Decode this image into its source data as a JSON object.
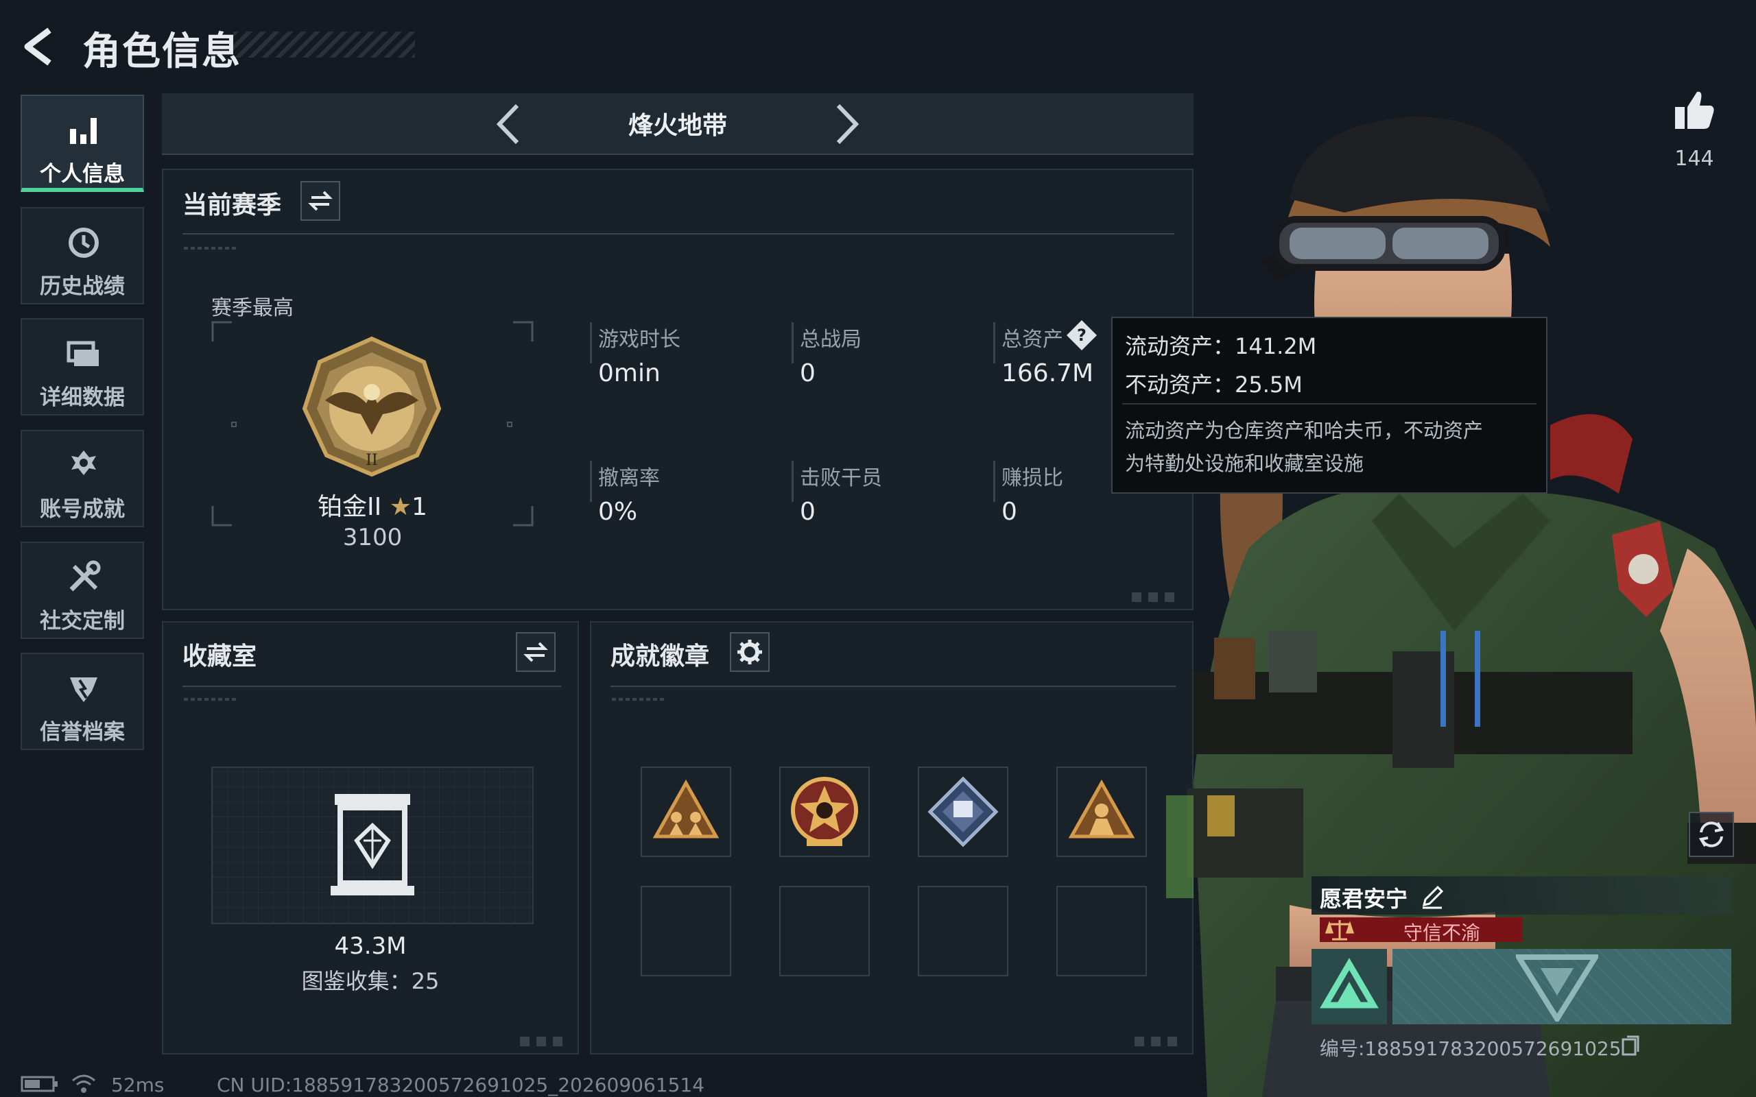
{
  "header": {
    "title": "角色信息"
  },
  "sidebar": {
    "items": [
      {
        "label": "个人信息",
        "icon": "bar-chart-icon",
        "active": true
      },
      {
        "label": "历史战绩",
        "icon": "history-icon"
      },
      {
        "label": "详细数据",
        "icon": "folders-icon"
      },
      {
        "label": "账号成就",
        "icon": "achievement-icon"
      },
      {
        "label": "社交定制",
        "icon": "tools-icon"
      },
      {
        "label": "信誉档案",
        "icon": "shield-icon"
      }
    ]
  },
  "mode_bar": {
    "mode_name": "烽火地带"
  },
  "season_panel": {
    "title": "当前赛季",
    "peak_label": "赛季最高",
    "rank_name": "铂金II",
    "rank_stars": "1",
    "rank_score": "3100",
    "stats": [
      {
        "label": "游戏时长",
        "value": "0min"
      },
      {
        "label": "总战局",
        "value": "0"
      },
      {
        "label": "总资产",
        "value": "166.7M"
      },
      {
        "label": "撤离率",
        "value": "0%"
      },
      {
        "label": "击败干员",
        "value": "0"
      },
      {
        "label": "赚损比",
        "value": "0"
      }
    ]
  },
  "tooltip": {
    "liquid": "流动资产：141.2M",
    "fixed": "不动资产：25.5M",
    "desc_line1": "流动资产为仓库资产和哈夫币，不动资产",
    "desc_line2": "为特勤处设施和收藏室设施"
  },
  "collection_panel": {
    "title": "收藏室",
    "value": "43.3M",
    "collection_count": "图鉴收集：25"
  },
  "achievement_panel": {
    "title": "成就徽章",
    "badges": [
      "triangle-team-badge",
      "skull-star-badge",
      "diamond-crest-badge",
      "triangle-soldier-badge"
    ]
  },
  "likes": {
    "count": "144"
  },
  "profile": {
    "name": "愿君安宁",
    "credit": "守信不渝",
    "uid": "编号:188591783200572691025"
  },
  "footer": {
    "ping": "52ms",
    "uid_line": "CN UID:188591783200572691025_202609061514"
  },
  "colors": {
    "accent_green": "#4fd39a",
    "credit_red": "#7a1318",
    "background": "#141a21"
  }
}
